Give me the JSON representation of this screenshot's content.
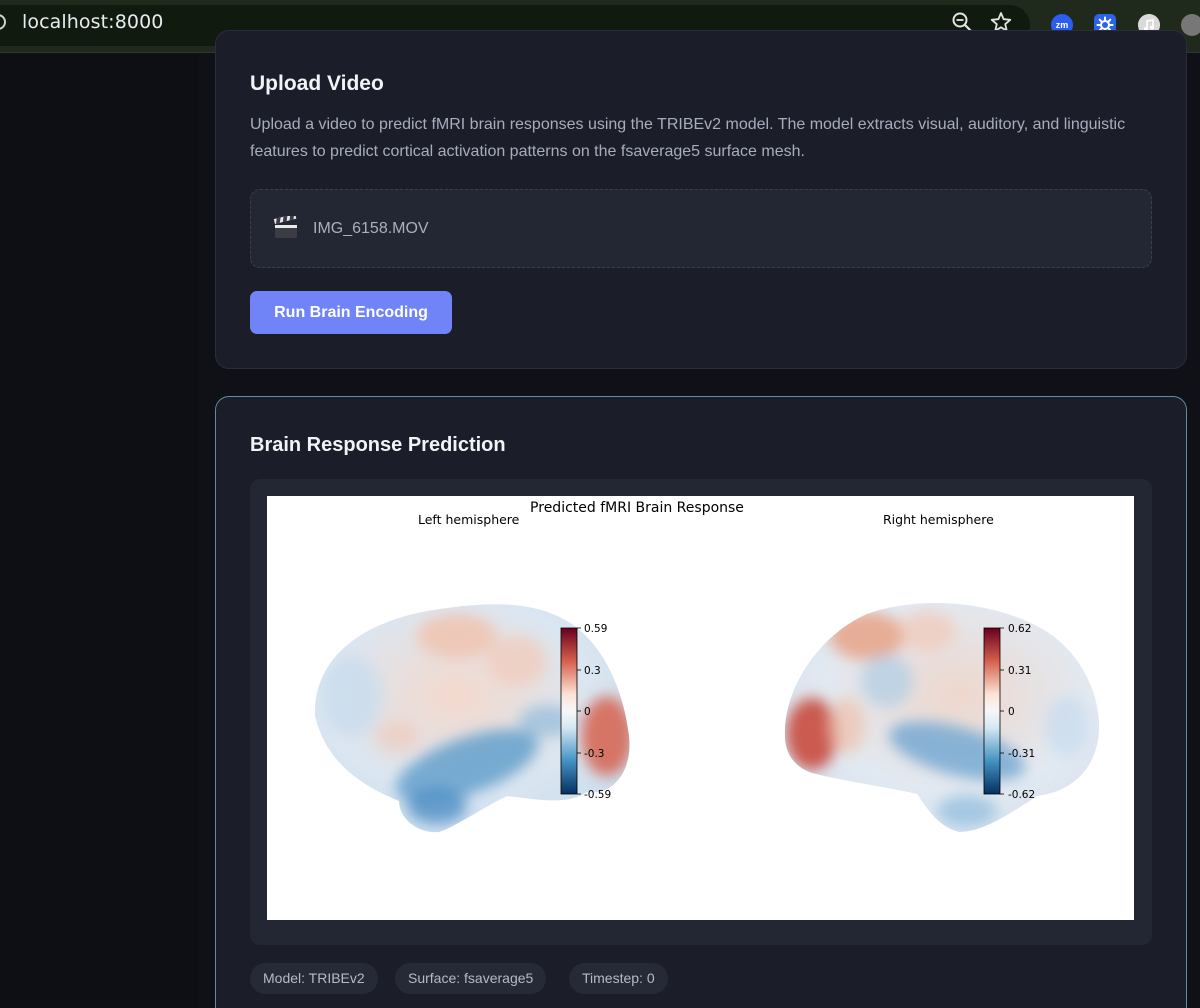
{
  "browser": {
    "url": "localhost:8000",
    "icons": [
      "zoom-out-icon",
      "bookmark-star-icon",
      "zoom-extension-icon",
      "gear-extension-icon",
      "music-extension-icon",
      "profile-avatar-icon"
    ],
    "zoom_ext_label": "zm"
  },
  "upload": {
    "title": "Upload Video",
    "description": "Upload a video to predict fMRI brain responses using the TRIBEv2 model. The model extracts visual, auditory, and linguistic features to predict cortical activation patterns on the fsaverage5 surface mesh.",
    "file_icon": "clapperboard-icon",
    "file_name": "IMG_6158.MOV",
    "button_label": "Run Brain Encoding",
    "accent_color": "#7083f7"
  },
  "result": {
    "title": "Brain Response Prediction",
    "figure": {
      "title": "Predicted fMRI Brain Response",
      "left_label": "Left hemisphere",
      "right_label": "Right hemisphere",
      "colormap": "RdBu_r",
      "left_colorbar_ticks": [
        "0.59",
        "0.3",
        "0",
        "-0.3",
        "-0.59"
      ],
      "right_colorbar_ticks": [
        "0.62",
        "0.31",
        "0",
        "-0.31",
        "-0.62"
      ]
    },
    "tags": {
      "model": "Model: TRIBEv2",
      "surface": "Surface: fsaverage5",
      "timestep": "Timestep: 0"
    }
  }
}
